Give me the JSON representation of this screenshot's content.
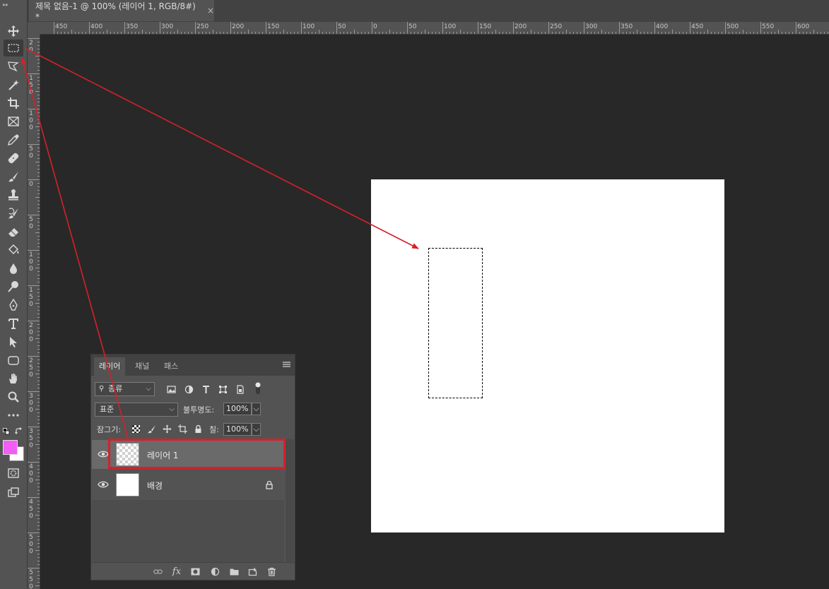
{
  "document_tab": {
    "title": "제목 없음-1 @ 100% (레이어 1, RGB/8#) *",
    "close": "×"
  },
  "toolbar": {
    "tools": [
      {
        "name": "move-tool",
        "icon": "move-icon"
      },
      {
        "name": "rectangular-marquee-tool",
        "icon": "marquee-icon",
        "selected": true
      },
      {
        "name": "lasso-tool",
        "icon": "polygonal-lasso-icon"
      },
      {
        "name": "magic-wand-tool",
        "icon": "magic-wand-icon"
      },
      {
        "name": "crop-tool",
        "icon": "crop-icon"
      },
      {
        "name": "frame-tool",
        "icon": "frame-icon"
      },
      {
        "name": "eyedropper-tool",
        "icon": "eyedropper-icon"
      },
      {
        "name": "healing-brush-tool",
        "icon": "bandage-icon"
      },
      {
        "name": "brush-tool",
        "icon": "brush-icon"
      },
      {
        "name": "clone-stamp-tool",
        "icon": "stamp-icon"
      },
      {
        "name": "history-brush-tool",
        "icon": "history-brush-icon"
      },
      {
        "name": "eraser-tool",
        "icon": "eraser-icon"
      },
      {
        "name": "paint-bucket-tool",
        "icon": "bucket-icon"
      },
      {
        "name": "blur-tool",
        "icon": "drop-icon"
      },
      {
        "name": "dodge-tool",
        "icon": "dodge-icon"
      },
      {
        "name": "pen-tool",
        "icon": "pen-icon"
      },
      {
        "name": "type-tool",
        "icon": "type-icon"
      },
      {
        "name": "path-selection-tool",
        "icon": "arrow-select-icon"
      },
      {
        "name": "rectangle-tool",
        "icon": "rounded-rect-icon"
      },
      {
        "name": "hand-tool",
        "icon": "hand-icon"
      },
      {
        "name": "zoom-tool",
        "icon": "zoom-icon"
      },
      {
        "name": "more-tools",
        "icon": "ellipsis-icon"
      }
    ],
    "foreground_color": "#f25df5",
    "background_color": "#ffffff"
  },
  "ruler": {
    "h_labels": [
      "450",
      "400",
      "350",
      "300",
      "250",
      "200",
      "150",
      "100",
      "50",
      "0",
      "50",
      "100",
      "150",
      "200",
      "250",
      "300",
      "350",
      "400",
      "450",
      "500",
      "550",
      "600"
    ],
    "v_labels": [
      "2\n0",
      "1\n5\n0",
      "1\n0\n0",
      "5\n0",
      "0",
      "5\n0",
      "1\n0\n0",
      "1\n5\n0",
      "2\n0\n0",
      "2\n5\n0",
      "3\n0\n0",
      "3\n5\n0",
      "4\n0\n0",
      "4\n5\n0",
      "5\n0\n0",
      "5\n5\n0"
    ]
  },
  "layers_panel": {
    "tabs": [
      "레이어",
      "채널",
      "패스"
    ],
    "filter_kind": "종류",
    "blend_mode": "표준",
    "opacity_label": "불투명도:",
    "opacity_value": "100%",
    "lock_label": "잠그기:",
    "fill_label": "칠:",
    "fill_value": "100%",
    "layers": [
      {
        "name": "레이어 1",
        "visible": true,
        "transparent": true,
        "selected": true
      },
      {
        "name": "배경",
        "visible": true,
        "transparent": false,
        "locked": true
      }
    ]
  },
  "annotation_color": "#d4212a"
}
